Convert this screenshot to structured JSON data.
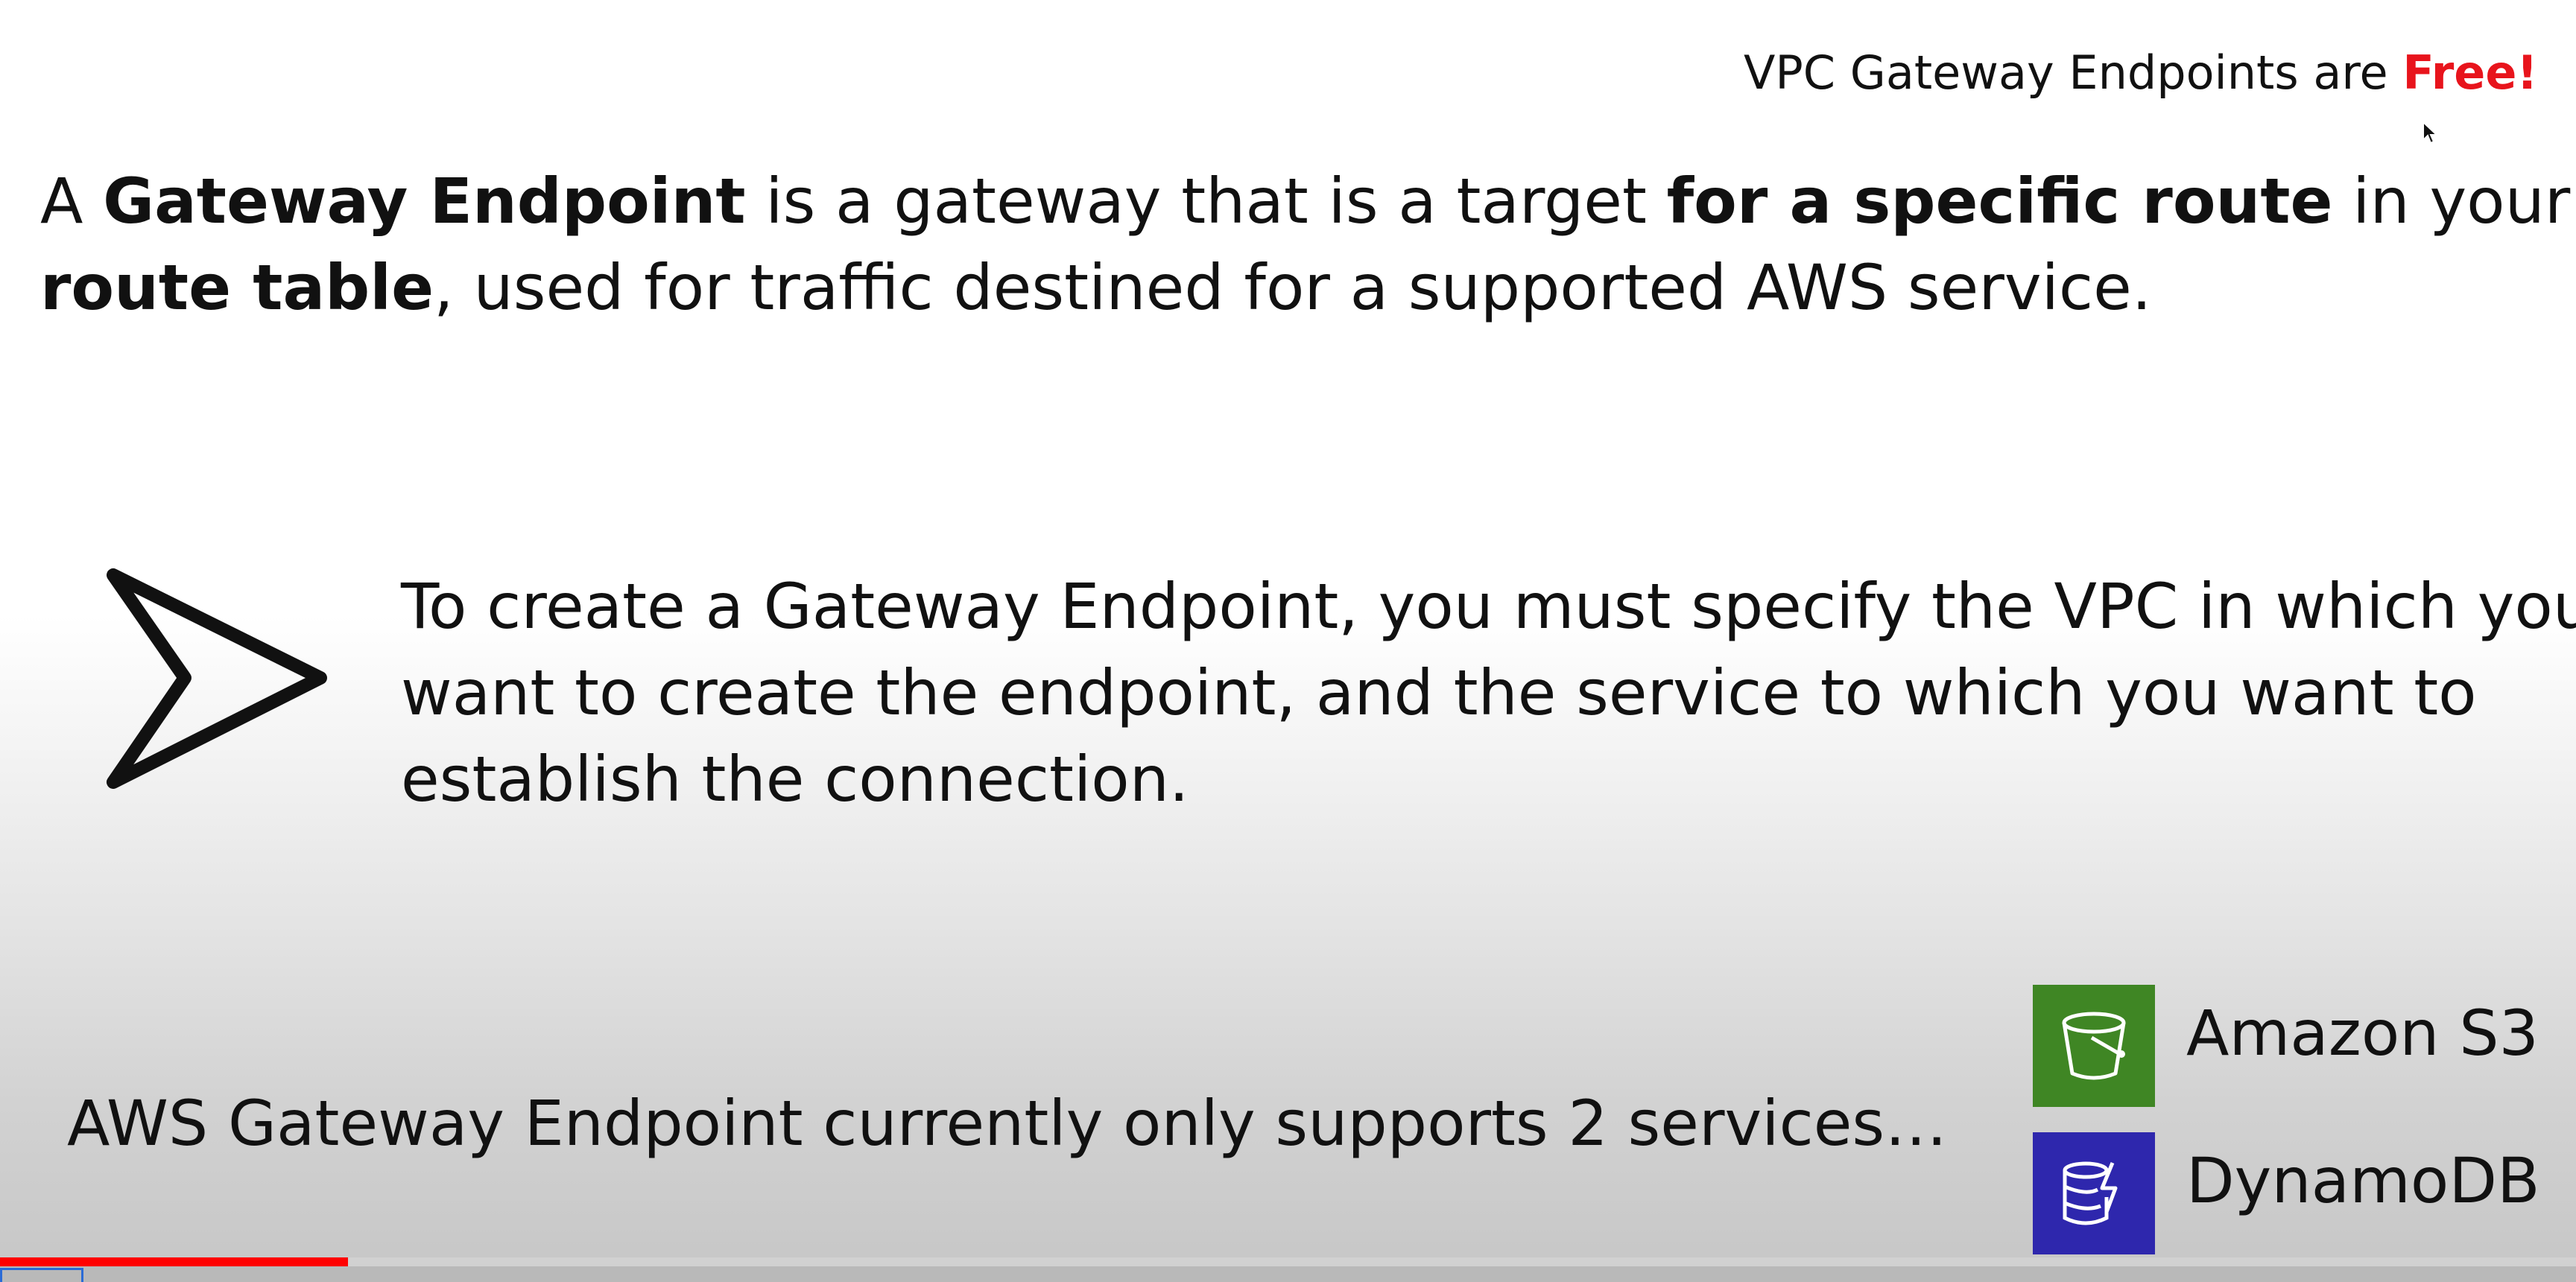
{
  "header_note": {
    "prefix": "VPC Gateway Endpoints are ",
    "highlight": "Free!",
    "highlight_color": "#e8141c"
  },
  "definition": {
    "p1": "A ",
    "b1": "Gateway Endpoint",
    "p2": " is a gateway that is a target ",
    "b2": "for a specific route",
    "p3": " in your ",
    "b3": "route table",
    "p4": ", used for traffic destined for a supported AWS service."
  },
  "create_text": "To create a Gateway Endpoint, you must specify the VPC in which you want to create the endpoint, and the service to which you want to establish the connection.",
  "supports_text": "AWS Gateway Endpoint currently only supports 2 services…",
  "services": [
    {
      "name": "Amazon S3",
      "icon": "s3-bucket-icon",
      "color": "#3f8624"
    },
    {
      "name": "DynamoDB",
      "icon": "dynamodb-icon",
      "color": "#2e27ad"
    }
  ],
  "arrow_icon": "chevron-arrow-right-icon",
  "video_progress": 0.135,
  "progress_color": "#ff0000"
}
